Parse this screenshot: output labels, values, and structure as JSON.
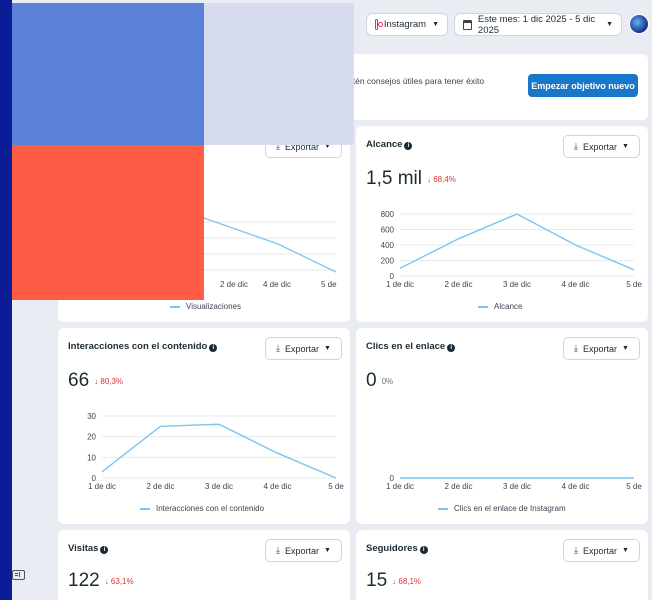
{
  "top_bar": {
    "platform": "Instagram",
    "date_range": "Este mes: 1 dic 2025 - 5 dic 2025"
  },
  "banner": {
    "text": "btén consejos útiles para tener éxito",
    "button": "Empezar objetivo nuevo"
  },
  "export_label": "Exportar",
  "info_glyph": "i",
  "cards": {
    "visualizaciones": {
      "legend": "Visualizaciones",
      "x_labels": [
        "2 de dic",
        "4 de dic",
        "5 de"
      ]
    },
    "alcance": {
      "title": "Alcance",
      "value": "1,5 mil",
      "delta": "↓ 68,4%",
      "legend": "Alcance"
    },
    "interacciones": {
      "title": "Interacciones con el contenido",
      "value": "66",
      "delta": "↓ 80,3%",
      "legend": "Interacciones con el contenido"
    },
    "clics": {
      "title": "Clics en el enlace",
      "value": "0",
      "delta": "0%",
      "legend": "Clics en el enlace de Instagram"
    },
    "visitas": {
      "title": "Visitas",
      "value": "122",
      "delta": "↓ 63,1%"
    },
    "seguidores": {
      "title": "Seguidores",
      "value": "15",
      "delta": "↓ 68,1%"
    }
  },
  "chart_data": [
    {
      "type": "line",
      "name": "alcance",
      "x": [
        "1 de dic",
        "2 de dic",
        "3 de dic",
        "4 de dic",
        "5 de"
      ],
      "series": [
        {
          "name": "Alcance",
          "values": [
            100,
            480,
            800,
            400,
            80
          ]
        }
      ],
      "yticks": [
        "0",
        "200",
        "400",
        "600",
        "800"
      ],
      "ylim": [
        0,
        800
      ],
      "color": "#7cc6ef"
    },
    {
      "type": "line",
      "name": "interacciones",
      "x": [
        "1 de dic",
        "2 de dic",
        "3 de dic",
        "4 de dic",
        "5 de"
      ],
      "series": [
        {
          "name": "Interacciones con el contenido",
          "values": [
            3,
            25,
            26,
            12,
            0
          ]
        }
      ],
      "yticks": [
        "0",
        "10",
        "20",
        "30"
      ],
      "ylim": [
        0,
        30
      ],
      "color": "#7cc6ef"
    },
    {
      "type": "line",
      "name": "clics",
      "x": [
        "1 de dic",
        "2 de dic",
        "3 de dic",
        "4 de dic",
        "5 de"
      ],
      "series": [
        {
          "name": "Clics en el enlace de Instagram",
          "values": [
            0,
            0,
            0,
            0,
            0
          ]
        }
      ],
      "yticks": [
        "0"
      ],
      "ylim": [
        0,
        1
      ],
      "color": "#7cc6ef"
    },
    {
      "type": "line",
      "name": "visualizaciones",
      "x": [
        "2 de dic",
        "4 de dic",
        "5 de"
      ],
      "series": [
        {
          "name": "Visualizaciones",
          "values": []
        }
      ],
      "color": "#7cc6ef"
    }
  ]
}
